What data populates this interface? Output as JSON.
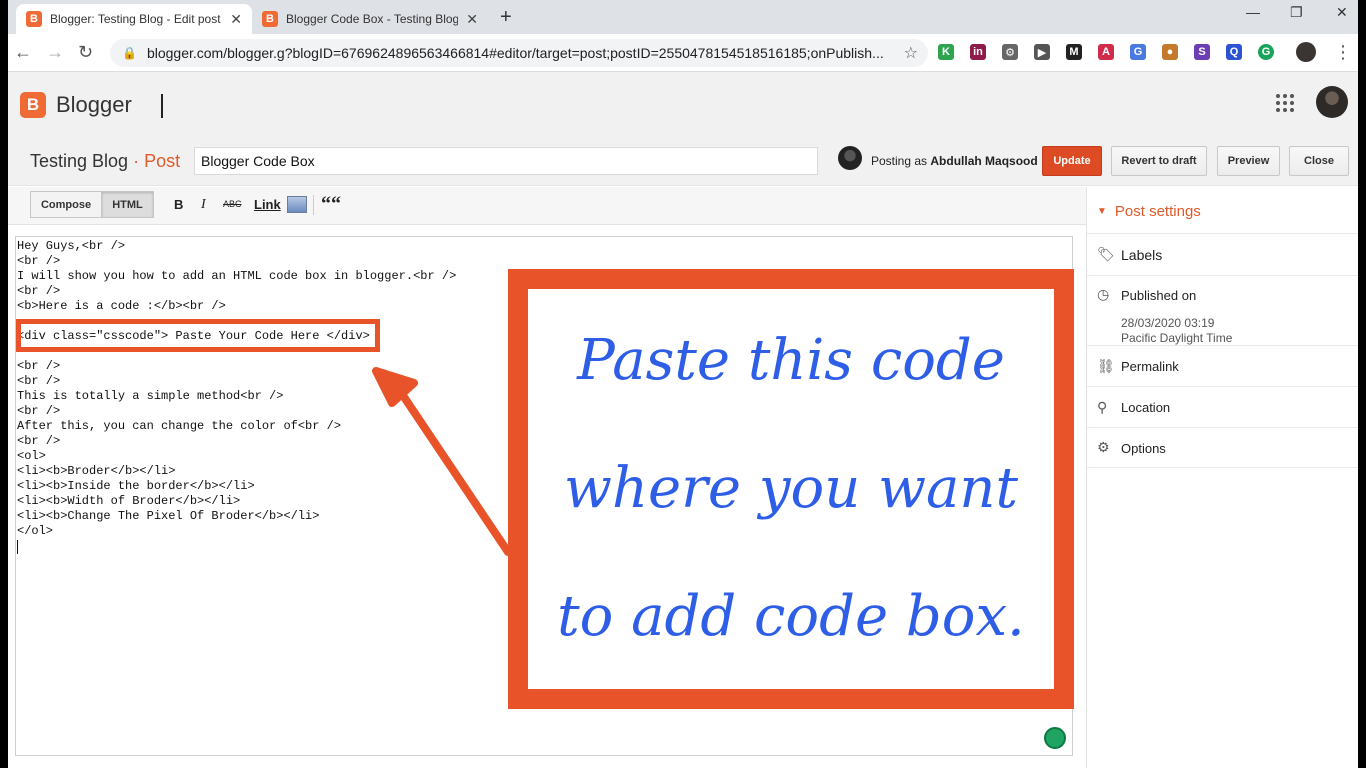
{
  "browser": {
    "tabs": [
      {
        "label": "Blogger: Testing Blog - Edit post",
        "favicon": "B"
      },
      {
        "label": "Blogger Code Box - Testing Blog",
        "favicon": "B"
      }
    ],
    "new_tab_icon": "+",
    "window_controls": [
      "—",
      "❐",
      "✕"
    ],
    "url": "blogger.com/blogger.g?blogID=6769624896563466814#editor/target=post;postID=2550478154518516185;onPublish...",
    "extensions": [
      {
        "glyph": "K",
        "color": "#2ea44f"
      },
      {
        "glyph": "in",
        "color": "#8e1b4a"
      },
      {
        "glyph": "⚙",
        "color": "#666666"
      },
      {
        "glyph": "▶",
        "color": "#555555"
      },
      {
        "glyph": "M",
        "color": "#222222"
      },
      {
        "glyph": "A",
        "color": "#d12b4c"
      },
      {
        "glyph": "G",
        "color": "#4a79e0"
      },
      {
        "glyph": "●",
        "color": "#c47a2a"
      },
      {
        "glyph": "S",
        "color": "#6b3fb3"
      },
      {
        "glyph": "Q",
        "color": "#2a54d1"
      },
      {
        "glyph": "G",
        "color": "#19a35b"
      }
    ]
  },
  "app": {
    "logo_letter": "B",
    "name": "Blogger"
  },
  "post": {
    "blog_name": "Testing Blog",
    "separator": " · ",
    "section": "Post",
    "title_value": "Blogger Code Box",
    "posting_as_prefix": "Posting as",
    "author": "Abdullah Maqsood",
    "buttons": {
      "update": "Update",
      "revert": "Revert to draft",
      "preview": "Preview",
      "close": "Close"
    }
  },
  "editor_toolbar": {
    "compose": "Compose",
    "html": "HTML",
    "bold": "B",
    "italic": "I",
    "strike": "ABC",
    "link": "Link",
    "quote": "““"
  },
  "editor": {
    "lines": [
      "Hey Guys,<br />",
      "<br />",
      "I will show you how to add an HTML code box in blogger.<br />",
      "<br />",
      "<b>Here is a code :</b><br />",
      "",
      "<div class=\"csscode\"> Paste Your Code Here </div>",
      "",
      "<br />",
      "<br />",
      "This is totally a simple method<br />",
      "<br />",
      "After this, you can change the color of<br />",
      "<br />",
      "<ol>",
      "<li><b>Broder</b></li>",
      "<li><b>Inside the border</b></li>",
      "<li><b>Width of Broder</b></li>",
      "<li><b>Change The Pixel Of Broder</b></li>",
      "</ol>"
    ],
    "callout": {
      "line1": "Paste this code",
      "line2": "where you want",
      "line3": "to add code box.",
      "border_color": "#e8532a",
      "text_color": "#2f5ee6"
    }
  },
  "sidebar": {
    "header": "Post settings",
    "labels": "Labels",
    "published_on": "Published on",
    "published_date": "28/03/2020 03:19",
    "published_tz": "Pacific Daylight Time",
    "permalink": "Permalink",
    "location": "Location",
    "options": "Options"
  },
  "colors": {
    "accent": "#e15a29",
    "update_button": "#dd4b24"
  }
}
